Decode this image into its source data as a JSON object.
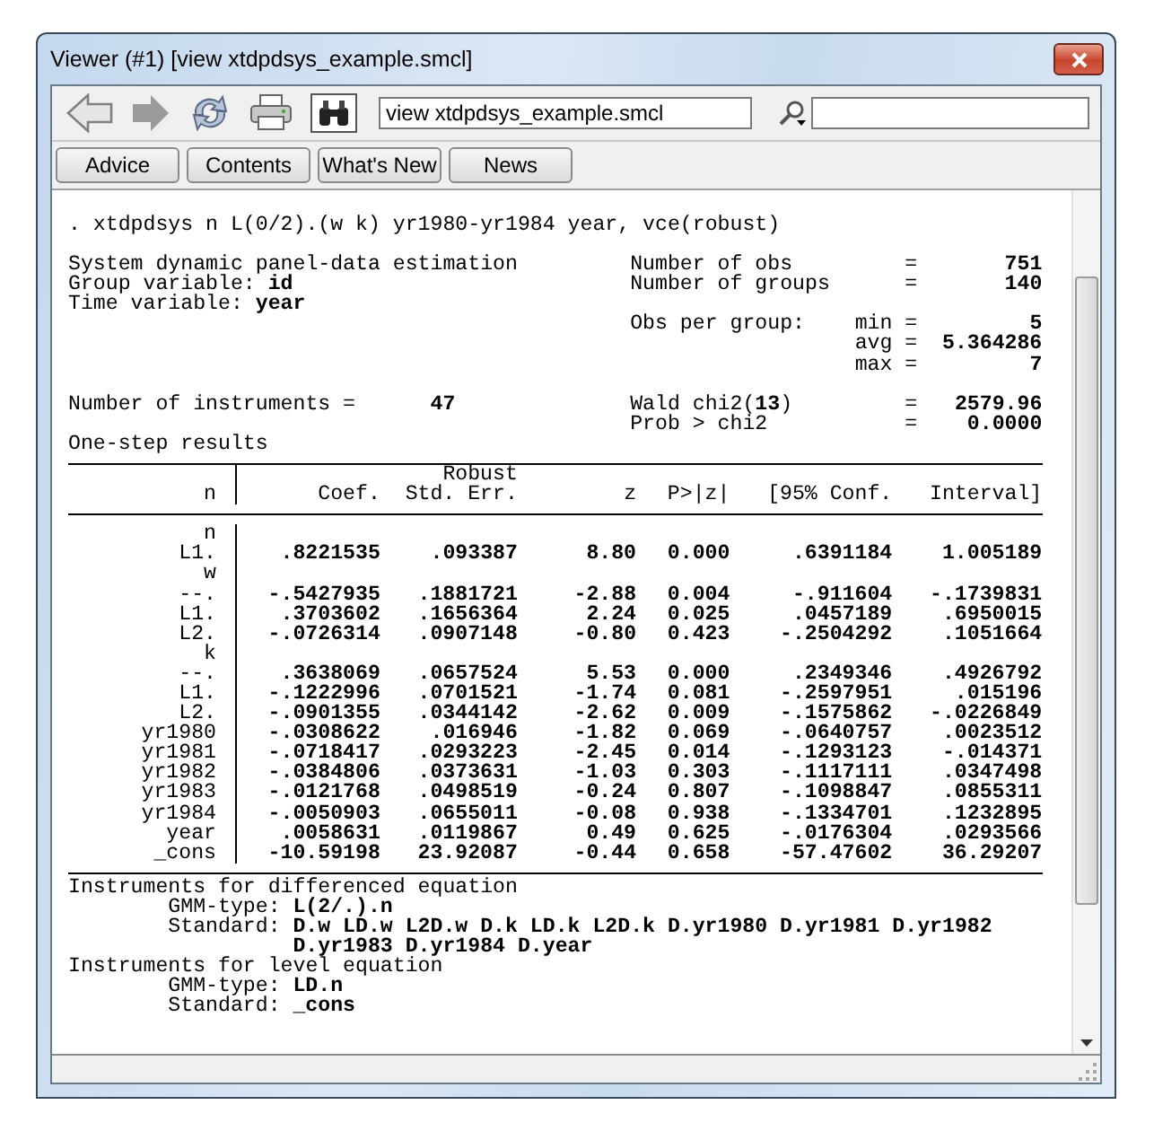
{
  "window": {
    "title": "Viewer (#1) [view xtdpdsys_example.smcl]"
  },
  "toolbar": {
    "address": "view xtdpdsys_example.smcl"
  },
  "links": [
    "Advice",
    "Contents",
    "What's New",
    "News"
  ],
  "output": {
    "command": ". xtdpdsys n L(0/2).(w k) yr1980-yr1984 year, vce(robust)",
    "title": "System dynamic panel-data estimation",
    "variables": [
      {
        "label": "Group variable:",
        "value": "id"
      },
      {
        "label": "Time variable:",
        "value": "year"
      }
    ],
    "instruments": {
      "label": "Number of instruments =",
      "value": "47"
    },
    "statistics": [
      [
        {
          "label": "Number of obs",
          "sign": "=",
          "value": "751"
        },
        {
          "label": "Number of groups",
          "sign": "=",
          "value": "140"
        }
      ],
      [
        {
          "label": "Obs per group:",
          "sub": "min",
          "sign": "=",
          "value": "5"
        },
        {
          "sub": "avg",
          "sign": "=",
          "value": "5.364286"
        },
        {
          "sub": "max",
          "sign": "=",
          "value": "7"
        }
      ],
      [
        {
          "label": "Wald chi2(**13**)",
          "sign": "=",
          "value": "2579.96"
        },
        {
          "label": "Prob > chi2",
          "sign": "=",
          "value": "0.0000"
        }
      ]
    ],
    "results_label": "One-step results",
    "table": {
      "robust": "Robust",
      "columns": [
        "n",
        "Coef.",
        "Std. Err.",
        "z",
        "P>|z|",
        "[95% Conf.",
        "Interval]"
      ],
      "rows": [
        {
          "kind": "group",
          "label": "n"
        },
        {
          "kind": "row",
          "label": "L1.",
          "values": [
            ".8221535",
            ".093387",
            "8.80",
            "0.000",
            ".6391184",
            "1.005189"
          ]
        },
        {
          "kind": "group",
          "label": "w"
        },
        {
          "kind": "row",
          "label": "--.",
          "values": [
            "-.5427935",
            ".1881721",
            "-2.88",
            "0.004",
            "-.911604",
            "-.1739831"
          ]
        },
        {
          "kind": "row",
          "label": "L1.",
          "values": [
            ".3703602",
            ".1656364",
            "2.24",
            "0.025",
            ".0457189",
            ".6950015"
          ]
        },
        {
          "kind": "row",
          "label": "L2.",
          "values": [
            "-.0726314",
            ".0907148",
            "-0.80",
            "0.423",
            "-.2504292",
            ".1051664"
          ]
        },
        {
          "kind": "group",
          "label": "k"
        },
        {
          "kind": "row",
          "label": "--.",
          "values": [
            ".3638069",
            ".0657524",
            "5.53",
            "0.000",
            ".2349346",
            ".4926792"
          ]
        },
        {
          "kind": "row",
          "label": "L1.",
          "values": [
            "-.1222996",
            ".0701521",
            "-1.74",
            "0.081",
            "-.2597951",
            ".015196"
          ]
        },
        {
          "kind": "row",
          "label": "L2.",
          "values": [
            "-.0901355",
            ".0344142",
            "-2.62",
            "0.009",
            "-.1575862",
            "-.0226849"
          ]
        },
        {
          "kind": "row",
          "label": "yr1980",
          "values": [
            "-.0308622",
            ".016946",
            "-1.82",
            "0.069",
            "-.0640757",
            ".0023512"
          ]
        },
        {
          "kind": "row",
          "label": "yr1981",
          "values": [
            "-.0718417",
            ".0293223",
            "-2.45",
            "0.014",
            "-.1293123",
            "-.014371"
          ]
        },
        {
          "kind": "row",
          "label": "yr1982",
          "values": [
            "-.0384806",
            ".0373631",
            "-1.03",
            "0.303",
            "-.1117111",
            ".0347498"
          ]
        },
        {
          "kind": "row",
          "label": "yr1983",
          "values": [
            "-.0121768",
            ".0498519",
            "-0.24",
            "0.807",
            "-.1098847",
            ".0855311"
          ]
        },
        {
          "kind": "row",
          "label": "yr1984",
          "values": [
            "-.0050903",
            ".0655011",
            "-0.08",
            "0.938",
            "-.1334701",
            ".1232895"
          ]
        },
        {
          "kind": "row",
          "label": "year",
          "values": [
            ".0058631",
            ".0119867",
            "0.49",
            "0.625",
            "-.0176304",
            ".0293566"
          ]
        },
        {
          "kind": "row",
          "label": "_cons",
          "values": [
            "-10.59198",
            "23.92087",
            "-0.44",
            "0.658",
            "-57.47602",
            "36.29207"
          ]
        }
      ]
    },
    "instrument_sections": [
      {
        "title": "Instruments for differenced equation",
        "entries": [
          {
            "label": "GMM-type:",
            "value": "L(2/.).n"
          },
          {
            "label": "Standard:",
            "value": "D.w LD.w L2D.w D.k LD.k L2D.k D.yr1980 D.yr1981 D.yr1982 D.yr1983 D.yr1984 D.year"
          }
        ]
      },
      {
        "title": "Instruments for level equation",
        "entries": [
          {
            "label": "GMM-type:",
            "value": "LD.n"
          },
          {
            "label": "Standard:",
            "value": "_cons"
          }
        ]
      }
    ]
  }
}
